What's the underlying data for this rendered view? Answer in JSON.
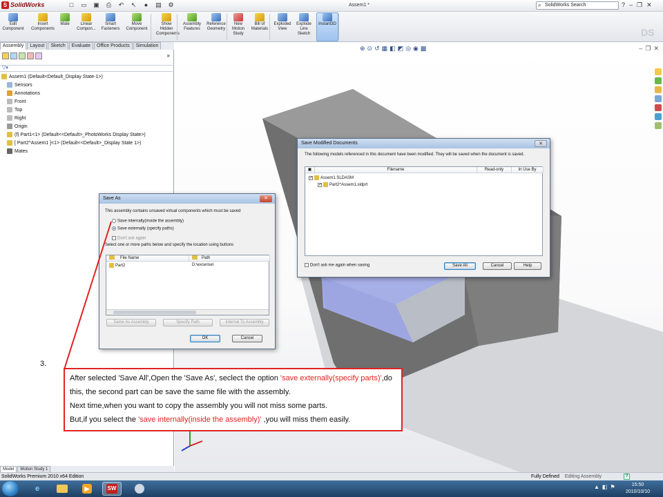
{
  "app": {
    "logo_text": "SolidWorks",
    "document_title": "Assem1 *",
    "search_placeholder": "SolidWorks Search"
  },
  "ribbon": {
    "buttons": [
      {
        "label": "Edit\nComponent"
      },
      {
        "label": "Insert\nComponents"
      },
      {
        "label": "Mate"
      },
      {
        "label": "Linear\nCompon..."
      },
      {
        "label": "Smart\nFasteners"
      },
      {
        "label": "Move\nComponent"
      },
      {
        "label": "Show\nHidden\nComponents"
      },
      {
        "label": "Assembly\nFeatures"
      },
      {
        "label": "Reference\nGeometry"
      },
      {
        "label": "New\nMotion\nStudy"
      },
      {
        "label": "Bill of\nMaterials"
      },
      {
        "label": "Exploded\nView"
      },
      {
        "label": "Explode\nLine\nSketch"
      },
      {
        "label": "Instant3D"
      }
    ]
  },
  "tabs": [
    "Assembly",
    "Layout",
    "Sketch",
    "Evaluate",
    "Office Products",
    "Simulation"
  ],
  "feature_tree": [
    "Assem1  (Default<Default_Display State-1>)",
    "Sensors",
    "Annotations",
    "Front",
    "Top",
    "Right",
    "Origin",
    "(f) Part1<1> (Default<<Default>_PhotoWorks Display State>)",
    "[ Part2^Assem1 ]<1> (Default<<Default>_Display State 1>)",
    "Mates"
  ],
  "bottom_tabs": [
    "Model",
    "Motion Study 1"
  ],
  "save_as": {
    "title": "Save As",
    "message": "This assembly contains unsaved virtual components which must be saved",
    "option_internal": "Save internally(inside the assembly)",
    "option_external": "Save externally (specify paths)",
    "dont_ask": "Don't ask again",
    "instruction": "Select one or more paths below and specify the location using buttons",
    "col_file_name": "File Name",
    "col_path": "Path",
    "row_file": "Part2",
    "row_path": "D:\\excerise\\",
    "btn_same_as_assembly": "Same As Assembly",
    "btn_specify_path": "Specify Path",
    "btn_internal": "Internal To Assembly",
    "btn_ok": "OK",
    "btn_cancel": "Cancel"
  },
  "save_modified": {
    "title": "Save Modified Documents",
    "message": "The following models referenced in this document have been modified. They will be saved when the document is saved.",
    "col_filename": "Filename",
    "col_readonly": "Read-only",
    "col_inuseby": "In Use By",
    "row1": "Assem1.SLDASM",
    "row2": "Part2^Assem1.sldprt",
    "dont_ask": "Don't ask me again when saving",
    "btn_save_all": "Save All",
    "btn_cancel": "Cancel",
    "btn_help": "Help"
  },
  "annotation": {
    "step": "3.",
    "line1_a": "After selected 'Save All',Open the 'Save As', seclect the option ",
    "line1_red": "'save externally(specify parts)'",
    "line1_b": ",do this, the second part can be save the same file with the assembly.",
    "line2": "Next time,when you want to copy the assembly you will not miss some parts.",
    "line3_a": "But,if you select the ",
    "line3_red": "'save internally(inside the assembly)'",
    "line3_b": " ,you will miss them easily."
  },
  "status": {
    "left": "SolidWorks Premium 2010 x64 Edition",
    "right": "Fully Defined",
    "right_partial": "Editing Assembly"
  },
  "taskbar": {
    "time": "15:50",
    "date": "2010/10/10"
  },
  "colors": {
    "annotation_red": "#e02222",
    "part_blue": "#9fa6e0",
    "part_gray": "#8c8c8c"
  }
}
